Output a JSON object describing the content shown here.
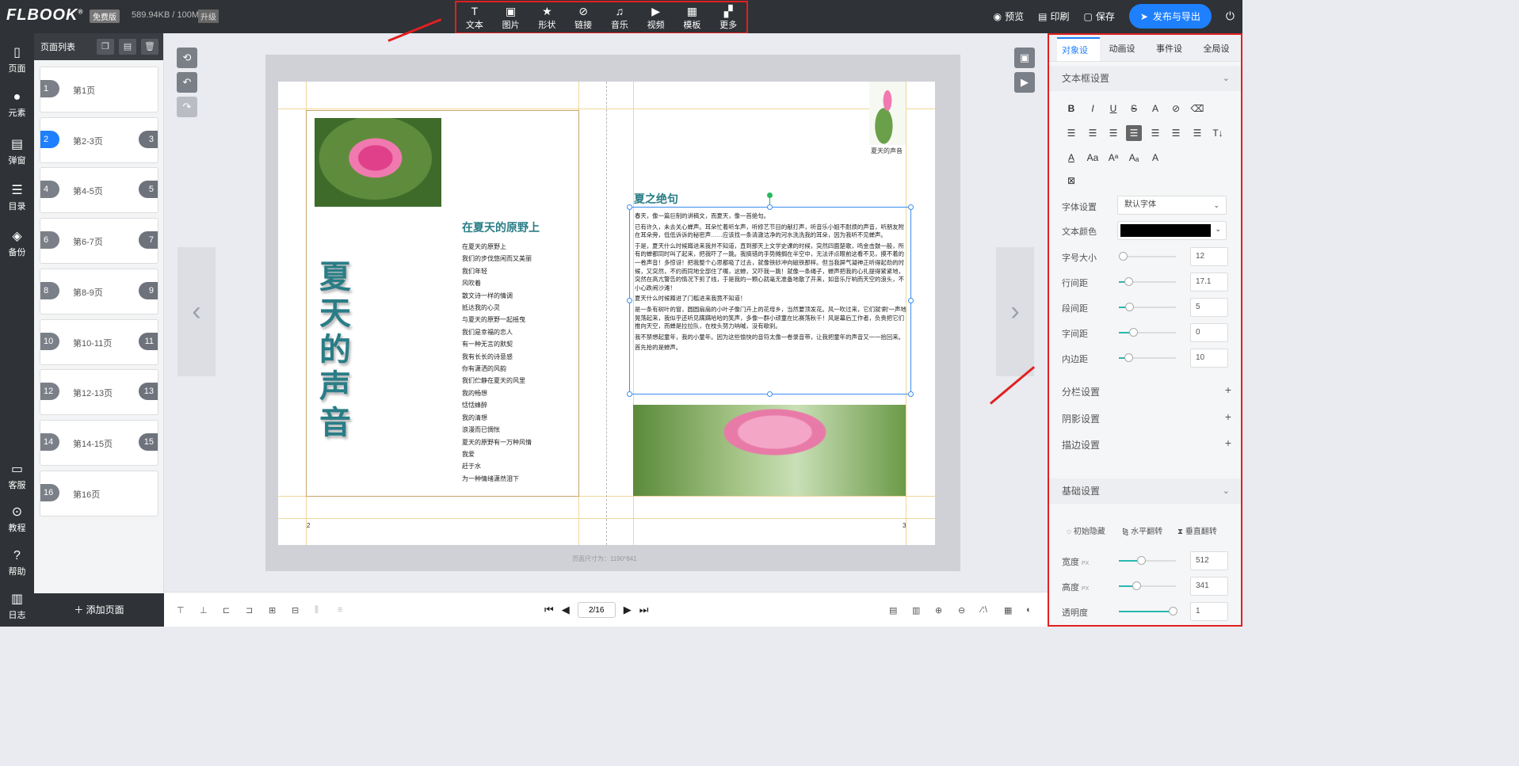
{
  "app": {
    "logo": "FLBOOK",
    "logo_reg": "®",
    "plan_badge": "免费版",
    "storage": "589.94KB / 100M",
    "upgrade": "升级"
  },
  "toolbar": {
    "items": [
      {
        "label": "文本",
        "icon": "text-icon"
      },
      {
        "label": "图片",
        "icon": "image-icon"
      },
      {
        "label": "形状",
        "icon": "star-icon"
      },
      {
        "label": "链接",
        "icon": "link-icon"
      },
      {
        "label": "音乐",
        "icon": "music-icon"
      },
      {
        "label": "视频",
        "icon": "video-icon"
      },
      {
        "label": "模板",
        "icon": "template-icon"
      },
      {
        "label": "更多",
        "icon": "more-icon"
      }
    ]
  },
  "topright": {
    "preview": "预览",
    "print": "印刷",
    "save": "保存",
    "publish": "发布与导出"
  },
  "leftnav": {
    "items": [
      {
        "label": "页面",
        "icon": "page-icon"
      },
      {
        "label": "元素",
        "icon": "element-icon"
      },
      {
        "label": "弹窗",
        "icon": "popup-icon"
      },
      {
        "label": "目录",
        "icon": "toc-icon"
      },
      {
        "label": "备份",
        "icon": "backup-icon"
      }
    ],
    "bottom_items": [
      {
        "label": "客服",
        "icon": "chat-icon"
      },
      {
        "label": "教程",
        "icon": "play-icon"
      },
      {
        "label": "帮助",
        "icon": "help-icon"
      },
      {
        "label": "日志",
        "icon": "log-icon"
      }
    ]
  },
  "pagelist": {
    "title": "页面列表",
    "pages": [
      {
        "left": "1",
        "label": "第1页",
        "right": ""
      },
      {
        "left": "2",
        "label": "第2-3页",
        "right": "3",
        "active": true
      },
      {
        "left": "4",
        "label": "第4-5页",
        "right": "5"
      },
      {
        "left": "6",
        "label": "第6-7页",
        "right": "7"
      },
      {
        "left": "8",
        "label": "第8-9页",
        "right": "9"
      },
      {
        "left": "10",
        "label": "第10-11页",
        "right": "11"
      },
      {
        "left": "12",
        "label": "第12-13页",
        "right": "13"
      },
      {
        "left": "14",
        "label": "第14-15页",
        "right": "15"
      },
      {
        "left": "16",
        "label": "第16页",
        "right": ""
      }
    ],
    "add_page": "添加页面"
  },
  "book": {
    "left_title": "夏天的声音",
    "poem_title": "在夏天的原野上",
    "poem_lines": [
      "在夏天的原野上",
      "我们的步伐悠闲而又美丽",
      "我们年轻",
      "风吹着",
      "散文诗一样的情调",
      "抵达我的心灵",
      "与夏天的原野一起摇曳",
      "我们是幸福的恋人",
      "有一种无言的默契",
      "我有长长的诗意感",
      "你有潇洒的风韵",
      "我们伫静在夏天的风里",
      "我的畅想",
      "恬恬蜂醉",
      "我的清想",
      "浪漫而已惆怅",
      "夏天的原野有一万种风情",
      "我爱",
      "赶于水",
      "为一种情绪潇然泪下"
    ],
    "left_page_num": "2",
    "right_page_num": "3",
    "right_title": "夏之绝句",
    "right_paragraphs": [
      "春天，像一篇巨制的讲稿文，而夏天，像一首绝句。",
      "已有许久，未去关心蝉声。耳朵忙着听车声，听修艺节目的献打声，听音乐小姐不耐烦的声音，听朋友附在耳朵旁，低低诉诉的秘密声……应该找一条清澈洁净的河水洗洗我的耳朵，因为我听不见蝉声。",
      "于是，夏天什么时候蹲进来我并不知道，直到那天上文学史课的时候，突然四面楚歌，鸣金击鼓一般，所有的蝉都同时叫了起来，把我吓了一跳。我搞错的手势摊搁在半空中，无法评点眼前这看不见，摸不着的一卷声音！多惊讶！把我整个心思都吸了过去，就像铁砂冲向磁铁那样。但当我屏气凝神正听得起劲的时候，又突然，不约而同地全部住了嘴，这蝉，又吓我一跳！就像一条绳子，蝉声把我的心扎提得紧紧地，突然在高亢警告的情况下剪了线，于是我的一颗心就毫无准备地散了开来，如音乐厅响而天空的浪头，不小心跌闹沙滩！",
      "夏天什么时候蹲进了门槛进来我竟不知道！",
      "是一条有树叶的窗，圆圆扇扇的小叶子像门卉上的花母乡，当然要顶发花。风一吹过来，它们就'刷'一声地晃荡起来，我似乎还听见蹒蹒哈哈的笑声，多像一群小顽童在比赛荡秋千！风是幕后工作者，负责把它们推向天空，而蝉是拉拉队，在枝头努力呐喊，没有歇刹。",
      "我不禁想起童年，我的小童年。因为这些愉快的音符太像一卷录音带，让我把童年的声音又一一拾回来。",
      "首先拾的是蝉声。"
    ],
    "lotus_caption": "夏天的声音",
    "page_size": "页面尺寸为：1190*841"
  },
  "bottombar": {
    "page_value": "2/16"
  },
  "rightpanel": {
    "tabs": [
      "对象设置",
      "动画设置",
      "事件设置",
      "全局设置"
    ],
    "textbox_section": "文本框设置",
    "font_label": "字体设置",
    "font_value": "默认字体",
    "color_label": "文本颜色",
    "text_color": "#000000",
    "props": [
      {
        "label": "字号大小",
        "value": "12",
        "level": 0.0
      },
      {
        "label": "行间距",
        "value": "17.1",
        "level": 0.1
      },
      {
        "label": "段间距",
        "value": "5",
        "level": 0.12
      },
      {
        "label": "字间距",
        "value": "0",
        "level": 0.2
      },
      {
        "label": "内边距",
        "value": "10",
        "level": 0.1
      }
    ],
    "collapse": [
      "分栏设置",
      "阴影设置",
      "描边设置"
    ],
    "basic_section": "基础设置",
    "basic_buttons": [
      "初始隐藏",
      "水平翻转",
      "垂直翻转"
    ],
    "basic_props": [
      {
        "label": "宽度",
        "unit": "PX",
        "value": "512",
        "level": 0.35
      },
      {
        "label": "高度",
        "unit": "PX",
        "value": "341",
        "level": 0.25
      },
      {
        "label": "透明度",
        "unit": "",
        "value": "1",
        "level": 0.95
      }
    ]
  },
  "colors": {
    "accent": "#1e80ff",
    "annotation": "#e02020",
    "title_teal": "#2a7d86"
  }
}
